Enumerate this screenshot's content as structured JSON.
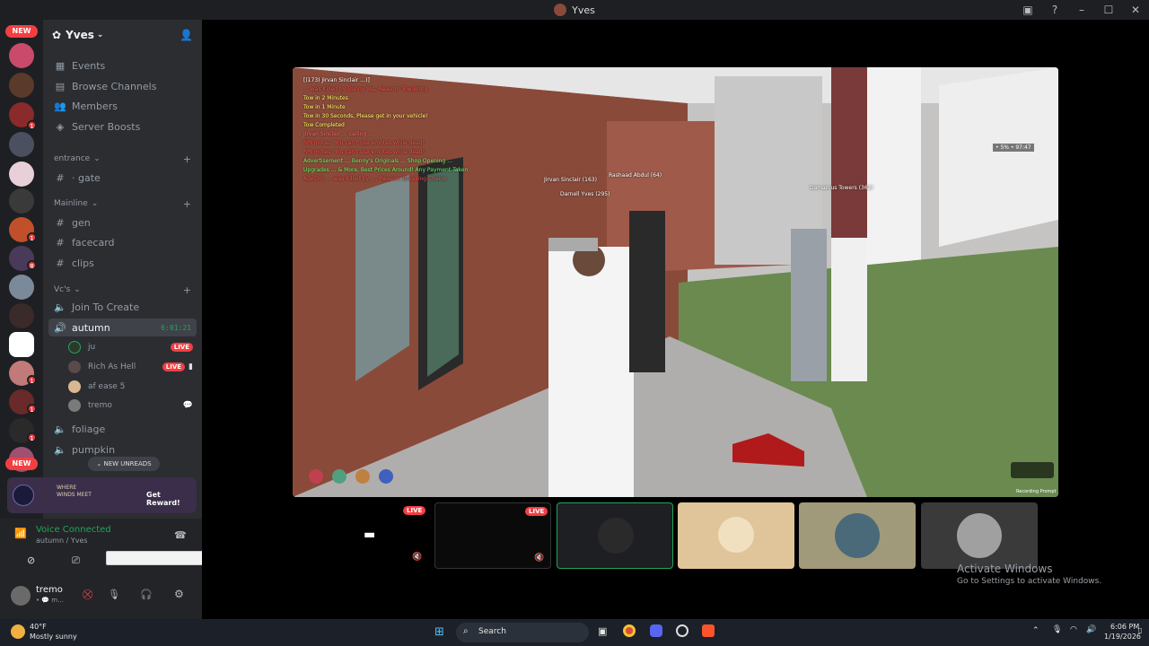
{
  "window": {
    "title": "Yves"
  },
  "server": {
    "name": "Yves"
  },
  "guild_badges": {
    "new_top": "NEW",
    "new_bottom": "NEW",
    "m1": "1",
    "m2": "1",
    "m3": "8",
    "m4": "1",
    "m5": "1",
    "m6": "1"
  },
  "menu": {
    "events": "Events",
    "browse": "Browse Channels",
    "members": "Members",
    "boosts": "Server Boosts"
  },
  "categories": {
    "entrance": "entrance",
    "mainline": "Mainline",
    "vcs": "Vc's"
  },
  "channels": {
    "gate": "· gate",
    "gen": "gen",
    "facecard": "facecard",
    "clips": "clips",
    "join": "Join To Create",
    "autumn": "autumn",
    "autumn_time": "6:01:21",
    "foliage": "foliage",
    "pumpkin": "pumpkin"
  },
  "voice_users": [
    {
      "name": "ju",
      "live": "LIVE"
    },
    {
      "name": "Rich As Hell",
      "live": "LIVE"
    },
    {
      "name": "af ease 5",
      "live": ""
    },
    {
      "name": "tremo",
      "live": ""
    }
  ],
  "new_unreads": "NEW UNREADS",
  "promo": {
    "text": "Get Reward!",
    "logo_line1": "WHERE",
    "logo_line2": "WINDS MEET"
  },
  "voice": {
    "status": "Voice Connected",
    "channel": "autumn / Yves"
  },
  "user": {
    "name": "tremo",
    "status": "• 💬 m..."
  },
  "stream": {
    "chat": [
      "[(173) Jirvan Sinclair …)]",
      "… was Killed by Bunny Yes, Reason: Tow-Bring",
      "Tow in 2 Minutes",
      "Tow in 1 Minute",
      "Tow in 30 Seconds, Please get in your vehicle!",
      "Tow Completed",
      "Jirvan Sinclair … calling …",
      "RPEmotes: You can't use emotes while dead!",
      "RPEmotes: You can't use emotes while dead!",
      "Advertisement … Benny's Originals … Shop Opening …",
      "Upgrades … & More, Best Prices Around! Any Payment Taken",
      "AdeCrd: … was Killed by …, Reason: Breaking Chains"
    ],
    "tags": [
      "Jirvan Sinclair (163)",
      "Darnell Yves (295)",
      "Rashaad Abdul (64)",
      "Damarcus Towers (362)"
    ],
    "hud": "• 5% • 97:47",
    "corner": "Recording Prompt"
  },
  "thumbs": [
    {
      "live": "LIVE"
    },
    {
      "live": "LIVE"
    }
  ],
  "activate": {
    "title": "Activate Windows",
    "sub": "Go to Settings to activate Windows."
  },
  "taskbar": {
    "temp": "40°F",
    "weather": "Mostly sunny",
    "search": "Search",
    "time": "6:06 PM",
    "date": "1/19/2026"
  }
}
